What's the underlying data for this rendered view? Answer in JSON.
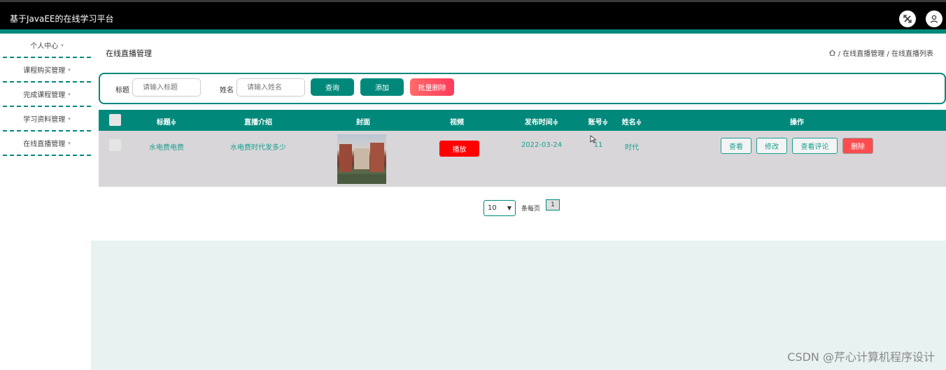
{
  "app": {
    "title": "基于JavaEE的在线学习平台"
  },
  "header_icons": [
    "close-fullscreen-icon",
    "user-icon"
  ],
  "sidebar": {
    "items": [
      {
        "label": "个人中心"
      },
      {
        "label": "课程购买管理"
      },
      {
        "label": "完成课程管理"
      },
      {
        "label": "学习资料管理"
      },
      {
        "label": "在线直播管理"
      }
    ],
    "caret": "▾"
  },
  "page": {
    "title": "在线直播管理",
    "breadcrumb": "/ 在线直播管理 / 在线直播列表"
  },
  "search": {
    "title_label": "标题",
    "title_placeholder": "请输入标题",
    "name_label": "姓名",
    "name_placeholder": "请输入姓名",
    "query_btn": "查询",
    "add_btn": "添加",
    "batch_delete_btn": "批量删除"
  },
  "table": {
    "headers": {
      "title": "标题≑",
      "intro": "直播介绍",
      "cover": "封面",
      "video": "视频",
      "time": "发布时间≑",
      "account": "账号≑",
      "name": "姓名≑",
      "ops": "操作"
    },
    "rows": [
      {
        "title": "水电费电费",
        "intro": "水电费时代发多少",
        "play": "播放",
        "time": "2022-03-24",
        "account": "11",
        "name": "时代",
        "view": "查看",
        "edit": "修改",
        "comments": "查看评论",
        "delete": "删除"
      }
    ]
  },
  "pagination": {
    "page_size": "10",
    "per_page_label": "条每页",
    "page": "1"
  },
  "watermark": "CSDN @芹心计算机程序设计",
  "colors": {
    "accent": "#00897b",
    "danger": "#ff0000",
    "topbar": "#000000"
  }
}
